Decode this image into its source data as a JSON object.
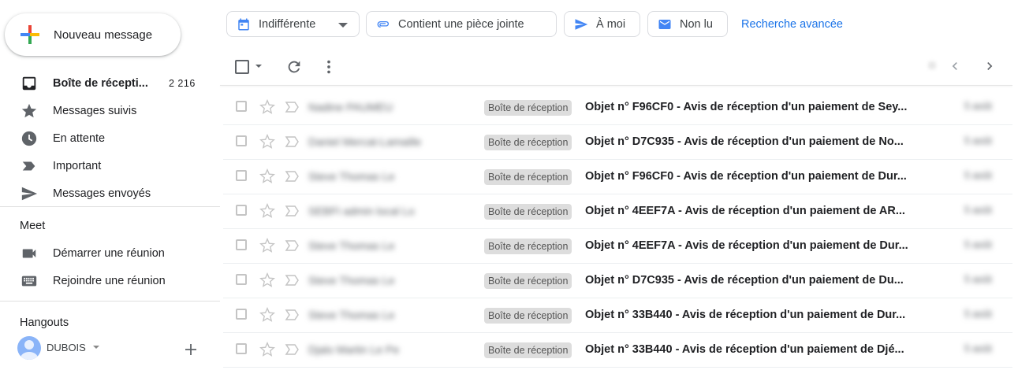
{
  "compose": {
    "label": "Nouveau message"
  },
  "nav": {
    "inbox": {
      "label": "Boîte de récepti...",
      "count": "2 216"
    },
    "starred": {
      "label": "Messages suivis"
    },
    "snoozed": {
      "label": "En attente"
    },
    "important": {
      "label": "Important"
    },
    "sent": {
      "label": "Messages envoyés"
    }
  },
  "meet": {
    "title": "Meet",
    "start": "Démarrer une réunion",
    "join": "Rejoindre une réunion"
  },
  "hangouts": {
    "title": "Hangouts",
    "user": "DUBOIS"
  },
  "filters": {
    "date": "Indifférente",
    "attachment": "Contient une pièce jointe",
    "to_me": "À moi",
    "unread": "Non lu",
    "advanced": "Recherche avancée"
  },
  "colors": {
    "accent": "#1a73e8",
    "label_bg": "#dddddd",
    "chip_icon_blue": "#4285f4"
  },
  "emails": [
    {
      "sender": "Nadine PAUMEU",
      "label": "Boîte de réception",
      "subject": "Objet n° F96CF0 - Avis de réception d'un paiement de Sey...",
      "date": "5 août"
    },
    {
      "sender": "Daniel Mercat-Lamaille",
      "label": "Boîte de réception",
      "subject": "Objet n° D7C935 - Avis de réception d'un paiement de No...",
      "date": "5 août"
    },
    {
      "sender": "Steve Thomas Le",
      "label": "Boîte de réception",
      "subject": "Objet n° F96CF0 - Avis de réception d'un paiement de Dur...",
      "date": "5 août"
    },
    {
      "sender": "SEBFI admin local Lo",
      "label": "Boîte de réception",
      "subject": "Objet n° 4EEF7A - Avis de réception d'un paiement de AR...",
      "date": "5 août"
    },
    {
      "sender": "Steve Thomas Le",
      "label": "Boîte de réception",
      "subject": "Objet n° 4EEF7A - Avis de réception d'un paiement de Dur...",
      "date": "5 août"
    },
    {
      "sender": "Steve Thomas Le",
      "label": "Boîte de réception",
      "subject": "Objet n° D7C935 - Avis de réception d'un paiement de Du...",
      "date": "5 août"
    },
    {
      "sender": "Steve Thomas Le",
      "label": "Boîte de réception",
      "subject": "Objet n° 33B440 - Avis de réception d'un paiement de Dur...",
      "date": "5 août"
    },
    {
      "sender": "Djalo Martin Le Pe",
      "label": "Boîte de réception",
      "subject": "Objet n° 33B440 - Avis de réception d'un paiement de Djé...",
      "date": "5 août"
    }
  ]
}
